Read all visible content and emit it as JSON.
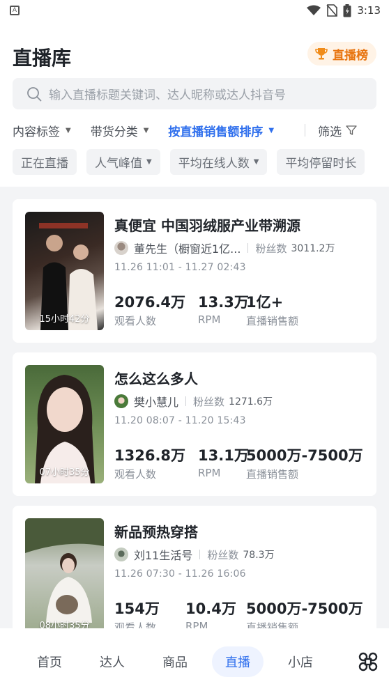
{
  "status_bar": {
    "left_icon": "A",
    "time": "3:13"
  },
  "header": {
    "title": "直播库",
    "rank_button": "直播榜",
    "search_placeholder": "输入直播标题关键词、达人昵称或达人抖音号"
  },
  "filters": {
    "items": [
      "内容标签",
      "带货分类",
      "按直播销售额排序"
    ],
    "active_index": 2,
    "screen_label": "筛选"
  },
  "chips": [
    "正在直播",
    "人气峰值",
    "平均在线人数",
    "平均停留时长"
  ],
  "cards": [
    {
      "title": "真便宜 中国羽绒服产业带溯源",
      "host": "董先生（橱窗近1亿...",
      "fans_label": "粉丝数",
      "fans": "3011.2万",
      "time": "11.26 11:01 - 11.27 02:43",
      "duration": "15小时42分",
      "stats": [
        {
          "value": "2076.4万",
          "label": "观看人数"
        },
        {
          "value": "13.3万",
          "label": "RPM"
        },
        {
          "value": "1亿+",
          "label": "直播销售额"
        }
      ]
    },
    {
      "title": "怎么这么多人",
      "host": "樊小慧儿",
      "fans_label": "粉丝数",
      "fans": "1271.6万",
      "time": "11.20 08:07 - 11.20 15:43",
      "duration": "07小时35分",
      "stats": [
        {
          "value": "1326.8万",
          "label": "观看人数"
        },
        {
          "value": "13.1万",
          "label": "RPM"
        },
        {
          "value": "5000万-7500万",
          "label": "直播销售额"
        }
      ]
    },
    {
      "title": "新品预热穿搭",
      "host": "刘11生活号",
      "fans_label": "粉丝数",
      "fans": "78.3万",
      "time": "11.26 07:30 - 11.26 16:06",
      "duration": "08小时35分",
      "stats": [
        {
          "value": "154万",
          "label": "观看人数"
        },
        {
          "value": "10.4万",
          "label": "RPM"
        },
        {
          "value": "5000万-7500万",
          "label": "直播销售额"
        }
      ]
    }
  ],
  "bottom_nav": {
    "items": [
      "首页",
      "达人",
      "商品",
      "直播",
      "小店"
    ],
    "active_index": 3,
    "more_icon": "command-icon"
  },
  "colors": {
    "accent": "#2f6fed",
    "rank_orange": "#e8740f"
  }
}
